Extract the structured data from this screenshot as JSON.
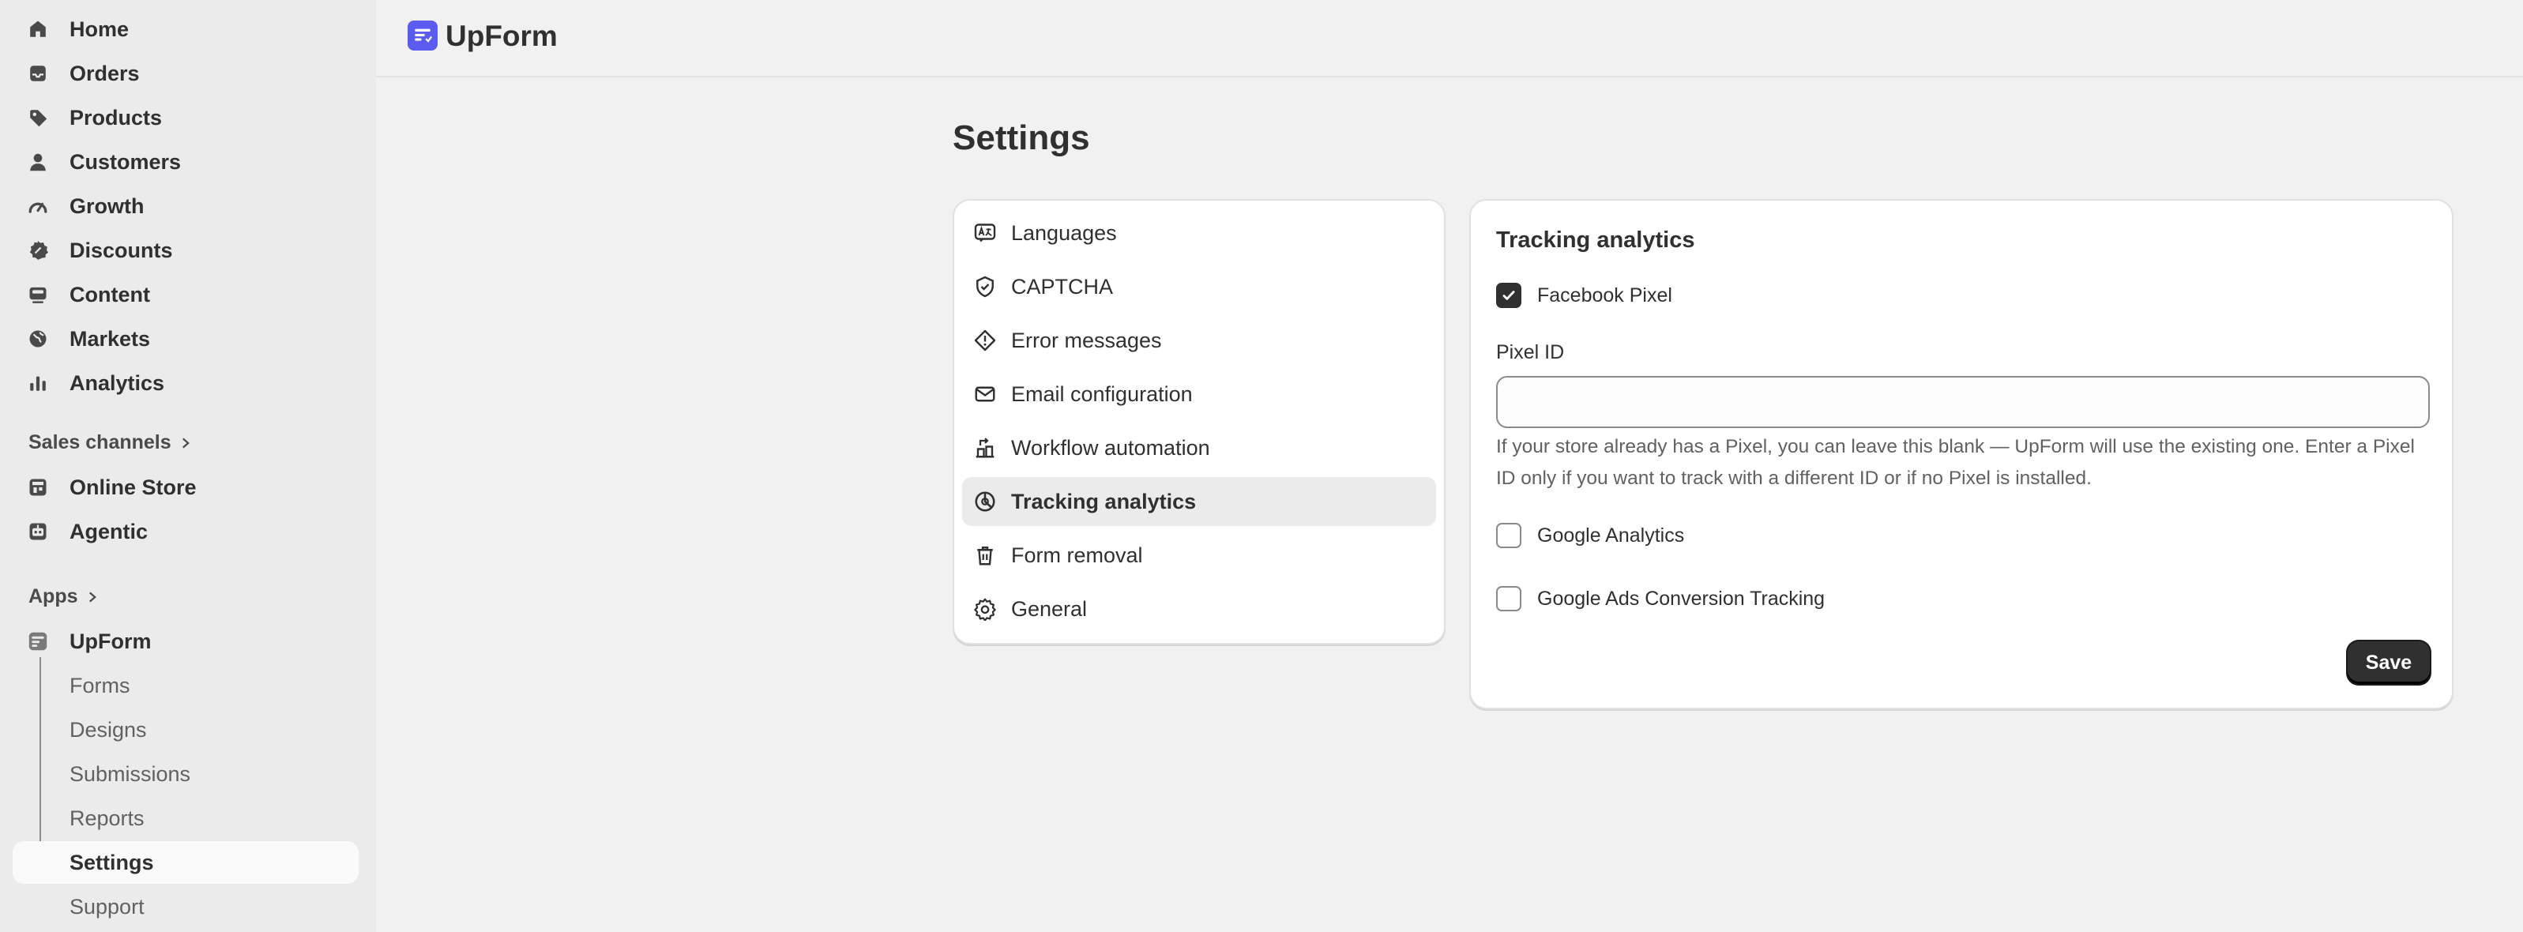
{
  "app": {
    "title": "UpForm",
    "accent_color": "#5b5bf0"
  },
  "sidebar": {
    "items": [
      {
        "label": "Home",
        "icon": "home-icon"
      },
      {
        "label": "Orders",
        "icon": "inbox-icon"
      },
      {
        "label": "Products",
        "icon": "tag-icon"
      },
      {
        "label": "Customers",
        "icon": "person-icon"
      },
      {
        "label": "Growth",
        "icon": "gauge-icon"
      },
      {
        "label": "Discounts",
        "icon": "discount-icon"
      },
      {
        "label": "Content",
        "icon": "content-icon"
      },
      {
        "label": "Markets",
        "icon": "globe-icon"
      },
      {
        "label": "Analytics",
        "icon": "bar-chart-icon"
      }
    ],
    "sales_channels_heading": "Sales channels",
    "channels": [
      {
        "label": "Online Store",
        "icon": "store-icon"
      },
      {
        "label": "Agentic",
        "icon": "robot-icon"
      }
    ],
    "apps_heading": "Apps",
    "app_item": {
      "label": "UpForm",
      "icon": "upform-app-icon"
    },
    "app_subitems": [
      {
        "label": "Forms"
      },
      {
        "label": "Designs"
      },
      {
        "label": "Submissions"
      },
      {
        "label": "Reports"
      },
      {
        "label": "Settings"
      },
      {
        "label": "Support"
      }
    ],
    "active_subitem": "Settings"
  },
  "page": {
    "title": "Settings"
  },
  "settings_menu": {
    "items": [
      {
        "label": "Languages",
        "icon": "translate-icon"
      },
      {
        "label": "CAPTCHA",
        "icon": "shield-check-icon"
      },
      {
        "label": "Error messages",
        "icon": "alert-diamond-icon"
      },
      {
        "label": "Email configuration",
        "icon": "email-icon"
      },
      {
        "label": "Workflow automation",
        "icon": "workflow-icon"
      },
      {
        "label": "Tracking analytics",
        "icon": "target-icon"
      },
      {
        "label": "Form removal",
        "icon": "trash-icon"
      },
      {
        "label": "General",
        "icon": "gear-icon"
      }
    ],
    "active": "Tracking analytics"
  },
  "tracking": {
    "section_title": "Tracking analytics",
    "facebook_pixel": {
      "label": "Facebook Pixel",
      "checked": true
    },
    "pixel_id": {
      "label": "Pixel ID",
      "value": "",
      "placeholder": ""
    },
    "help_text": "If your store already has a Pixel, you can leave this blank — UpForm will use the existing one. Enter a Pixel ID only if you want to track with a different ID or if no Pixel is installed.",
    "google_analytics": {
      "label": "Google Analytics",
      "checked": false
    },
    "google_ads": {
      "label": "Google Ads Conversion Tracking",
      "checked": false
    },
    "save_label": "Save"
  }
}
